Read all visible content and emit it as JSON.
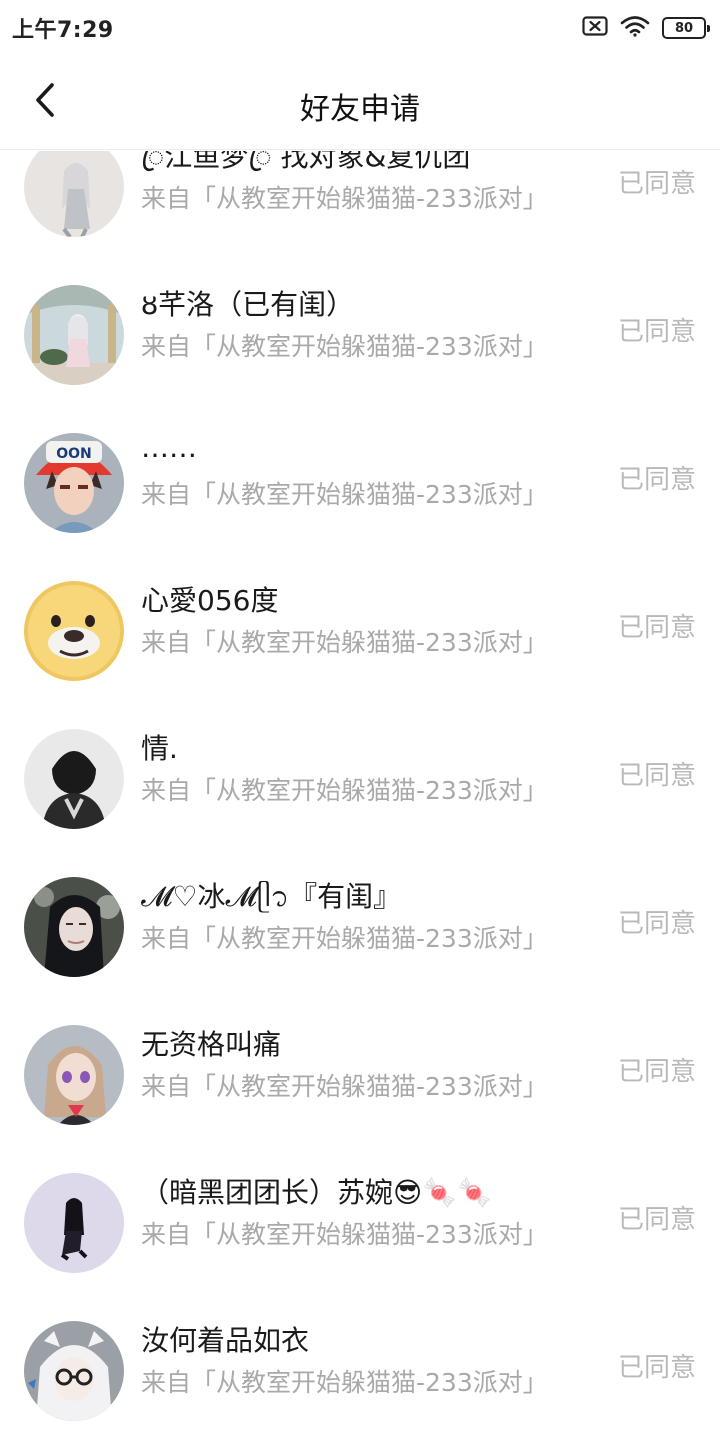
{
  "status_bar": {
    "time": "上午7:29",
    "battery": "80",
    "icons": [
      "sim-x-icon",
      "wifi-icon",
      "battery-icon"
    ]
  },
  "header": {
    "title": "好友申请",
    "back_icon": "chevron-left-icon"
  },
  "requests": [
    {
      "name": "ꦿ江鱼梦ꦿ  找对象&复仇团",
      "source": "来自「从教室开始躲猫猫-233派对」",
      "status": "已同意"
    },
    {
      "name": "ȣ芊洛（已有闺）",
      "source": "来自「从教室开始躲猫猫-233派对」",
      "status": "已同意"
    },
    {
      "name": "……",
      "source": "来自「从教室开始躲猫猫-233派对」",
      "status": "已同意"
    },
    {
      "name": "心愛056度",
      "source": "来自「从教室开始躲猫猫-233派对」",
      "status": "已同意"
    },
    {
      "name": "情.",
      "source": "来自「从教室开始躲猫猫-233派对」",
      "status": "已同意"
    },
    {
      "name": "𝓜♡冰𝓜ᥫ᭡『有闺』",
      "source": "来自「从教室开始躲猫猫-233派对」",
      "status": "已同意"
    },
    {
      "name": "无资格叫痛",
      "source": "来自「从教室开始躲猫猫-233派对」",
      "status": "已同意"
    },
    {
      "name": "（暗黑团团长）苏婉😎🍬🍬",
      "source": "来自「从教室开始躲猫猫-233派对」",
      "status": "已同意"
    },
    {
      "name": "汝何着品如衣",
      "source": "来自「从教室开始躲猫猫-233派对」",
      "status": "已同意"
    }
  ]
}
